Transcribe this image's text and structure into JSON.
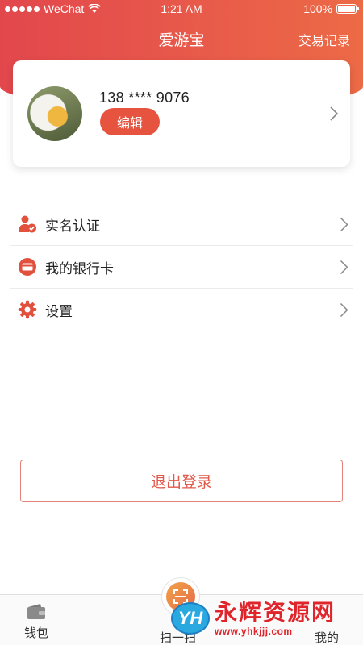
{
  "status_bar": {
    "carrier": "WeChat",
    "time": "1:21 AM",
    "battery": "100%",
    "battery_level": 1.0
  },
  "nav": {
    "title": "爱游宝",
    "right_action": "交易记录"
  },
  "profile": {
    "phone": "138 **** 9076",
    "edit_label": "编辑"
  },
  "menu": [
    {
      "label": "实名认证",
      "icon": "id-verify-icon"
    },
    {
      "label": "我的银行卡",
      "icon": "bank-card-icon"
    },
    {
      "label": "设置",
      "icon": "gear-icon"
    }
  ],
  "logout_label": "退出登录",
  "tabs": [
    {
      "label": "钱包",
      "icon": "wallet-icon"
    },
    {
      "label": "扫一扫",
      "icon": "scan-icon"
    },
    {
      "label": "我的",
      "icon": "user-icon"
    }
  ],
  "watermark": {
    "logo_text": "YH",
    "title": "永辉资源网",
    "url": "www.yhkjjj.com"
  },
  "colors": {
    "brand_red": "#e2474c",
    "brand_orange": "#ec6a46",
    "accent": "#e6533f"
  }
}
